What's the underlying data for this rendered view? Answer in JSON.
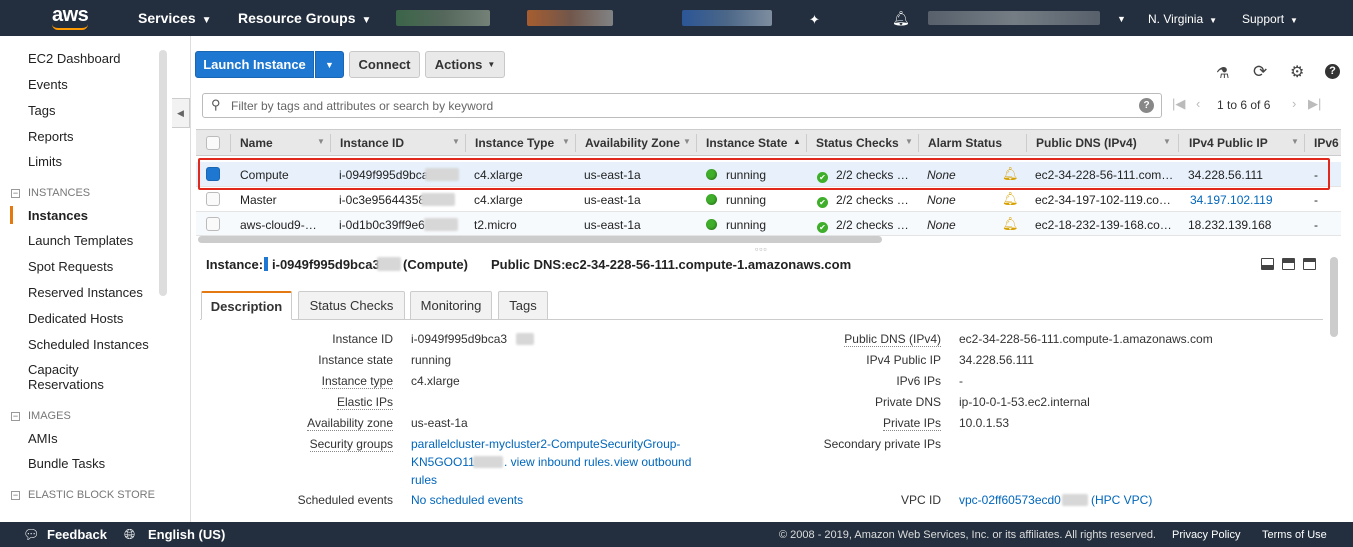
{
  "topnav": {
    "logo": "aws",
    "services": "Services",
    "resource_groups": "Resource Groups",
    "region": "N. Virginia",
    "support": "Support"
  },
  "sidebar": {
    "top_items": [
      "EC2 Dashboard",
      "Events",
      "Tags",
      "Reports",
      "Limits"
    ],
    "instances_header": "INSTANCES",
    "instances_items": [
      "Instances",
      "Launch Templates",
      "Spot Requests",
      "Reserved Instances",
      "Dedicated Hosts",
      "Scheduled Instances",
      "Capacity",
      "Reservations"
    ],
    "images_header": "IMAGES",
    "images_items": [
      "AMIs",
      "Bundle Tasks"
    ],
    "ebs_header": "ELASTIC BLOCK STORE"
  },
  "toolbar": {
    "launch_label": "Launch Instance",
    "connect_label": "Connect",
    "actions_label": "Actions"
  },
  "filter": {
    "placeholder": "Filter by tags and attributes or search by keyword",
    "pager_text": "1 to 6 of 6"
  },
  "table": {
    "columns": [
      "Name",
      "Instance ID",
      "Instance Type",
      "Availability Zone",
      "Instance State",
      "Status Checks",
      "Alarm Status",
      "Public DNS (IPv4)",
      "IPv4 Public IP",
      "IPv6"
    ],
    "rows": [
      {
        "name": "Compute",
        "id": "i-0949f995d9bca",
        "type": "c4.xlarge",
        "az": "us-east-1a",
        "state": "running",
        "checks": "2/2 checks …",
        "alarm": "None",
        "dns": "ec2-34-228-56-111.com…",
        "ip": "34.228.56.111",
        "ipv6": "-"
      },
      {
        "name": "Master",
        "id": "i-0c3e95644358",
        "type": "c4.xlarge",
        "az": "us-east-1a",
        "state": "running",
        "checks": "2/2 checks …",
        "alarm": "None",
        "dns": "ec2-34-197-102-119.co…",
        "ip": "34.197.102.119",
        "ipv6": "-"
      },
      {
        "name": "aws-cloud9-…",
        "id": "i-0d1b0c39ff9e6",
        "type": "t2.micro",
        "az": "us-east-1a",
        "state": "running",
        "checks": "2/2 checks …",
        "alarm": "None",
        "dns": "ec2-18-232-139-168.co…",
        "ip": "18.232.139.168",
        "ipv6": "-"
      }
    ]
  },
  "detail": {
    "instance_label": "Instance:",
    "instance_id": "i-0949f995d9bca3",
    "instance_suffix": "(Compute)",
    "dns_label": "Public DNS:",
    "dns_value": "ec2-34-228-56-111.compute-1.amazonaws.com",
    "tabs": [
      "Description",
      "Status Checks",
      "Monitoring",
      "Tags"
    ],
    "left": [
      {
        "label": "Instance ID",
        "value": "i-0949f995d9bca3"
      },
      {
        "label": "Instance state",
        "value": "running"
      },
      {
        "label": "Instance type",
        "value": "c4.xlarge"
      },
      {
        "label": "Elastic IPs",
        "value": ""
      },
      {
        "label": "Availability zone",
        "value": "us-east-1a"
      },
      {
        "label": "Security groups",
        "value": "parallelcluster-mycluster2-ComputeSecurityGroup-"
      },
      {
        "label": "Scheduled events",
        "value": "No scheduled events"
      }
    ],
    "sg_line2_a": "KN5GOO11",
    "sg_line2_b": ". view inbound rules.",
    "sg_line2_c": "view outbound",
    "sg_line3": "rules",
    "right": [
      {
        "label": "Public DNS (IPv4)",
        "value": "ec2-34-228-56-111.compute-1.amazonaws.com"
      },
      {
        "label": "IPv4 Public IP",
        "value": "34.228.56.111"
      },
      {
        "label": "IPv6 IPs",
        "value": "-"
      },
      {
        "label": "Private DNS",
        "value": "ip-10-0-1-53.ec2.internal"
      },
      {
        "label": "Private IPs",
        "value": "10.0.1.53"
      },
      {
        "label": "Secondary private IPs",
        "value": ""
      },
      {
        "label": "VPC ID",
        "value": "vpc-02ff60573ecd0"
      }
    ],
    "vpc_suffix": "(HPC VPC)"
  },
  "footer": {
    "feedback": "Feedback",
    "language": "English (US)",
    "copyright": "© 2008 - 2019, Amazon Web Services, Inc. or its affiliates. All rights reserved.",
    "privacy": "Privacy Policy",
    "terms": "Terms of Use"
  },
  "colors": {
    "nav_bg": "#232f3e",
    "primary": "#1e77d1",
    "accent": "#e47911",
    "highlight": "#e0291c",
    "link": "#0066bb",
    "running": "#3fae2a"
  },
  "icons": [
    "pin-icon",
    "bell-icon",
    "flask-icon",
    "refresh-icon",
    "gear-icon",
    "help-icon",
    "search-icon",
    "globe-icon",
    "feedback-icon"
  ]
}
